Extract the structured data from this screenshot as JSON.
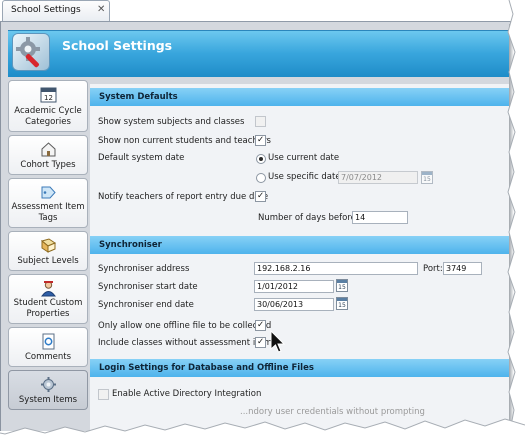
{
  "window": {
    "tab_label": "School Settings",
    "tab_close": "✕"
  },
  "header": {
    "title": "School Settings",
    "logo_icon": "gear-wrench-icon"
  },
  "nav": {
    "items": [
      {
        "label": "Academic Cycle Categories",
        "icon": "calendar-icon",
        "active": false
      },
      {
        "label": "Cohort Types",
        "icon": "house-icon",
        "active": false
      },
      {
        "label": "Assessment Item Tags",
        "icon": "tag-icon",
        "active": false
      },
      {
        "label": "Subject Levels",
        "icon": "book-icon",
        "active": false
      },
      {
        "label": "Student Custom Properties",
        "icon": "student-icon",
        "active": false
      },
      {
        "label": "Comments",
        "icon": "comment-icon",
        "active": false
      },
      {
        "label": "System Items",
        "icon": "gear-icon",
        "active": true
      }
    ]
  },
  "system_defaults": {
    "title": "System Defaults",
    "show_subjects_label": "Show system subjects and classes",
    "show_subjects_checked": false,
    "show_non_current_label": "Show non current students and teachers",
    "show_non_current_checked": true,
    "default_date_label": "Default system date",
    "use_current_label": "Use current date",
    "use_current_selected": true,
    "use_specific_label": "Use specific date",
    "use_specific_selected": false,
    "specific_date_value": "7/07/2012",
    "notify_label": "Notify teachers of report entry due date",
    "notify_checked": true,
    "days_before_label": "Number of days before",
    "days_before_value": "14"
  },
  "synchroniser": {
    "title": "Synchroniser",
    "address_label": "Synchroniser address",
    "address_value": "192.168.2.16",
    "port_label": "Port:",
    "port_value": "3749",
    "start_label": "Synchroniser start date",
    "start_value": "1/01/2012",
    "end_label": "Synchroniser end date",
    "end_value": "30/06/2013",
    "calendar_day": "15",
    "offline_label": "Only allow one offline file to be collected",
    "offline_checked": true,
    "include_classes_label": "Include classes without assessment items",
    "include_classes_checked": true
  },
  "login": {
    "title": "Login Settings for Database and Offline Files",
    "ad_label": "Enable Active Directory Integration",
    "ad_checked": false,
    "cred_label": "...ndory user credentials without prompting"
  },
  "colors": {
    "accent": "#39a6dd",
    "section": "#4eb3ec",
    "panel": "#f1f3f6",
    "frame": "#d4d8de"
  }
}
